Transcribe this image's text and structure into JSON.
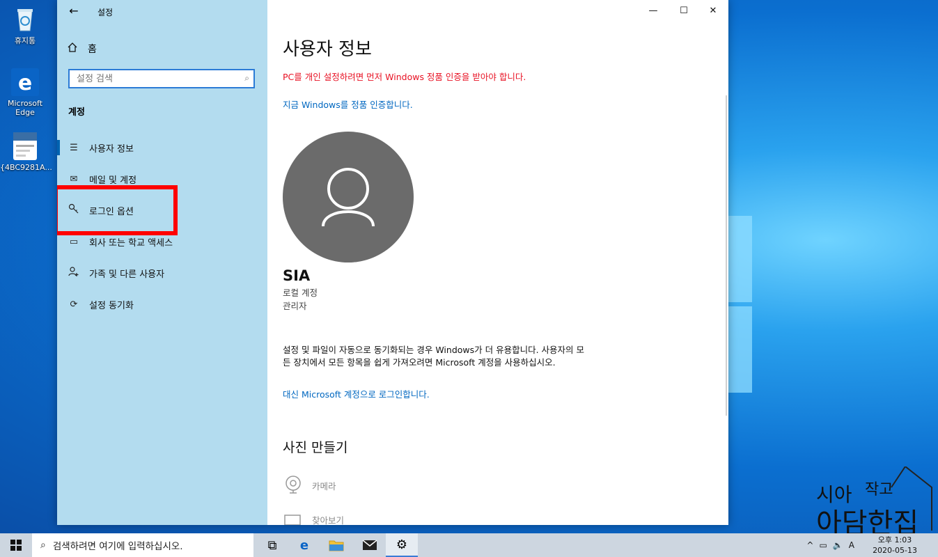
{
  "desktop": {
    "icons": [
      {
        "label": "휴지통",
        "icon": "recycle-bin-icon"
      },
      {
        "label": "Microsoft Edge",
        "icon": "edge-icon"
      },
      {
        "label": "{4BC9281A...",
        "icon": "file-thumbnail-icon"
      }
    ]
  },
  "window": {
    "title": "설정",
    "back_icon": "arrow-left-icon",
    "controls": {
      "minimize": "—",
      "maximize": "☐",
      "close": "✕"
    }
  },
  "sidebar": {
    "home_label": "홈",
    "search_placeholder": "설정 검색",
    "section_title": "계정",
    "items": [
      {
        "label": "사용자 정보",
        "icon": "person-list-icon",
        "active": true
      },
      {
        "label": "메일 및 계정",
        "icon": "mail-icon"
      },
      {
        "label": "로그인 옵션",
        "icon": "key-icon"
      },
      {
        "label": "회사 또는 학교 액세스",
        "icon": "briefcase-icon"
      },
      {
        "label": "가족 및 다른 사용자",
        "icon": "person-add-icon"
      },
      {
        "label": "설정 동기화",
        "icon": "sync-icon"
      }
    ]
  },
  "main": {
    "title": "사용자 정보",
    "activation_warning": "PC를 개인 설정하려면 먼저 Windows 정품 인증을 받아야 합니다.",
    "activate_link": "지금 Windows를 정품 인증합니다.",
    "user": {
      "name": "SIA",
      "account_type": "로컬 계정",
      "role": "관리자"
    },
    "sync_paragraph": "설정 및 파일이 자동으로 동기화되는 경우 Windows가 더 유용합니다. 사용자의 모든 장치에서 모든 항목을 쉽게 가져오려면 Microsoft 계정을 사용하십시오.",
    "ms_account_link": "대신 Microsoft 계정으로 로그인합니다.",
    "photo_section_title": "사진 만들기",
    "photo_options": [
      {
        "label": "카메라",
        "icon": "camera-icon"
      },
      {
        "label": "찾아보기",
        "icon": "folder-browse-icon"
      }
    ]
  },
  "taskbar": {
    "search_placeholder": "검색하려면 여기에 입력하십시오.",
    "apps": [
      "task-view-icon",
      "edge-icon",
      "file-explorer-icon",
      "mail-icon",
      "settings-gear-icon"
    ],
    "tray": {
      "ime": "A"
    },
    "clock": {
      "time": "오후 1:03",
      "date": "2020-05-13"
    }
  },
  "watermark_text": "시아의 작고 아담한 집",
  "colors": {
    "accent": "#0067c0",
    "warning": "#e81123",
    "sidebar_bg": "#b3dcef",
    "highlight_box": "#ff0000"
  }
}
